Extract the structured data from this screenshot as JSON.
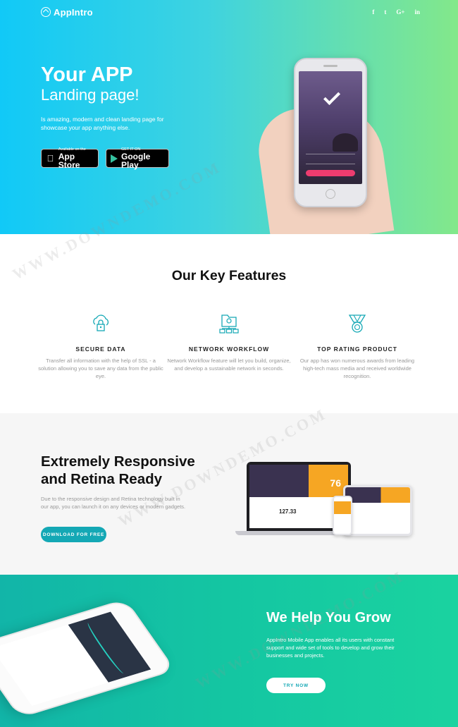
{
  "nav": {
    "brand": "AppIntro",
    "social": [
      "f",
      "t",
      "G+",
      "in"
    ]
  },
  "hero": {
    "title": "Your APP",
    "subtitle": "Landing page!",
    "text": "Is amazing, modern and clean landing page for showcase your app anything else.",
    "app_store": {
      "small": "Available on the",
      "big": "App Store"
    },
    "google_play": {
      "small": "GET IT ON",
      "big": "Google Play"
    }
  },
  "features": {
    "heading": "Our Key Features",
    "items": [
      {
        "title": "SECURE DATA",
        "text": "Transfer all information with the help of SSL - a solution allowing you to save any data from the public eye.",
        "icon": "cloud-lock-icon"
      },
      {
        "title": "NETWORK WORKFLOW",
        "text": "Network Workflow feature will let you build, organize, and develop a sustainable network in seconds.",
        "icon": "network-folder-icon"
      },
      {
        "title": "TOP RATING PRODUCT",
        "text": "Our app has won numerous awards from leading high-tech mass media and received worldwide recognition.",
        "icon": "medal-icon"
      }
    ]
  },
  "responsive": {
    "heading_line1": "Extremely Responsive",
    "heading_line2": "and Retina Ready",
    "text": "Due to the responsive design and Retina technology built in our app, you can launch it on any devices or modern gadgets.",
    "button": "DOWNLOAD FOR FREE",
    "screen_number": "76",
    "screen_value": "127.33"
  },
  "grow": {
    "heading": "We Help You Grow",
    "text": "AppIntro Mobile App enables all its users with constant support and wide set of tools to develop and grow their businesses and projects.",
    "button": "TRY NOW"
  },
  "watermark": "WWW.DOWNDEMO.COM",
  "colors": {
    "hero_start": "#11c9f7",
    "hero_end": "#83e88a",
    "accent": "#14a8b5",
    "grow": "#14c6a2"
  }
}
